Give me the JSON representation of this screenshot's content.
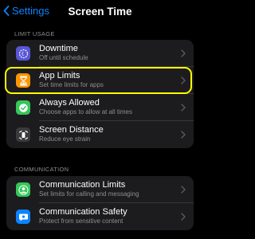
{
  "nav": {
    "back_label": "Settings",
    "title": "Screen Time"
  },
  "limit_usage": {
    "header": "LIMIT USAGE",
    "items": [
      {
        "title": "Downtime",
        "subtitle": "Off until schedule",
        "icon": "downtime-icon",
        "color": "#5856d6"
      },
      {
        "title": "App Limits",
        "subtitle": "Set time limits for apps",
        "icon": "hourglass-icon",
        "color": "#ff9500"
      },
      {
        "title": "Always Allowed",
        "subtitle": "Choose apps to allow at all times",
        "icon": "checkmark-icon",
        "color": "#34c759"
      },
      {
        "title": "Screen Distance",
        "subtitle": "Reduce eye strain",
        "icon": "screen-distance-icon",
        "color": "#3a3a3c"
      }
    ]
  },
  "communication": {
    "header": "COMMUNICATION",
    "items": [
      {
        "title": "Communication Limits",
        "subtitle": "Set limits for calling and messaging",
        "icon": "person-icon",
        "color": "#34c759"
      },
      {
        "title": "Communication Safety",
        "subtitle": "Protect from sensitive content",
        "icon": "message-bubble-icon",
        "color": "#0a84ff"
      }
    ]
  },
  "highlight_color": "#fffb00"
}
